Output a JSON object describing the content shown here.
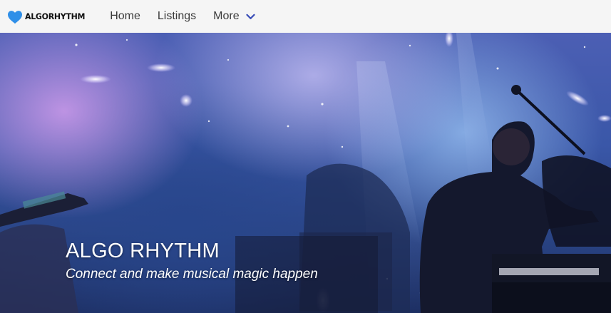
{
  "navbar": {
    "brand": {
      "logo_text": "ALGORHYTHM",
      "logo_icon": "heart-icon",
      "logo_color": "#2f8fe8"
    },
    "links": [
      {
        "label": "Home"
      },
      {
        "label": "Listings"
      },
      {
        "label": "More",
        "icon": "chevron-down-icon",
        "icon_color": "#3b4fb8"
      }
    ]
  },
  "hero": {
    "title": "ALGO RHYTHM",
    "subtitle": "Connect and make musical magic happen",
    "image": "concert-stage-photo"
  }
}
